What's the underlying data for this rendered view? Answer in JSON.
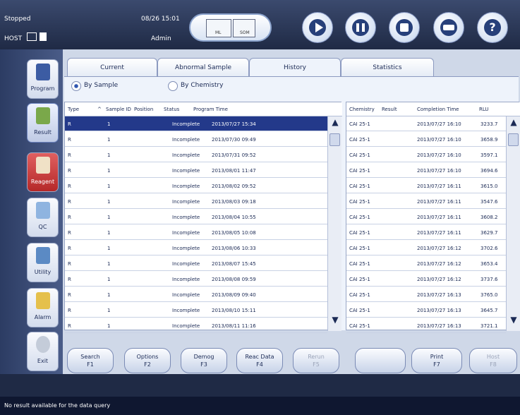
{
  "status": {
    "state": "Stopped",
    "datetime": "08/26 15:01",
    "host_label": "HOST",
    "user": "Admin"
  },
  "host_modules": {
    "module1": "ML",
    "module2": "SOM"
  },
  "sidebar": {
    "items": [
      {
        "label": "Program",
        "icon": "program-icon"
      },
      {
        "label": "Result",
        "icon": "result-icon"
      },
      {
        "label": "Reagent",
        "icon": "reagent-icon"
      },
      {
        "label": "QC",
        "icon": "qc-icon"
      },
      {
        "label": "Utility",
        "icon": "utility-icon"
      },
      {
        "label": "Alarm",
        "icon": "alarm-icon"
      },
      {
        "label": "Exit",
        "icon": "exit-icon"
      }
    ]
  },
  "tabs": [
    "Current",
    "Abnormal Sample",
    "History",
    "Statistics"
  ],
  "radio": {
    "by_sample": "By Sample",
    "by_chemistry": "By Chemistry"
  },
  "table1": {
    "headers": [
      "Type",
      "^",
      "Sample ID",
      "Position",
      "Status",
      "Program Time"
    ],
    "rows": [
      [
        "R",
        "1",
        "Incomplete",
        "2013/07/27 15:34"
      ],
      [
        "R",
        "1",
        "Incomplete",
        "2013/07/30 09:49"
      ],
      [
        "R",
        "1",
        "Incomplete",
        "2013/07/31 09:52"
      ],
      [
        "R",
        "1",
        "Incomplete",
        "2013/08/01 11:47"
      ],
      [
        "R",
        "1",
        "Incomplete",
        "2013/08/02 09:52"
      ],
      [
        "R",
        "1",
        "Incomplete",
        "2013/08/03 09:18"
      ],
      [
        "R",
        "1",
        "Incomplete",
        "2013/08/04 10:55"
      ],
      [
        "R",
        "1",
        "Incomplete",
        "2013/08/05 10:08"
      ],
      [
        "R",
        "1",
        "Incomplete",
        "2013/08/06 10:33"
      ],
      [
        "R",
        "1",
        "Incomplete",
        "2013/08/07 15:45"
      ],
      [
        "R",
        "1",
        "Incomplete",
        "2013/08/08 09:59"
      ],
      [
        "R",
        "1",
        "Incomplete",
        "2013/08/09 09:40"
      ],
      [
        "R",
        "1",
        "Incomplete",
        "2013/08/10 15:11"
      ],
      [
        "R",
        "1",
        "Incomplete",
        "2013/08/11 11:16"
      ]
    ]
  },
  "table2": {
    "headers": [
      "Chemistry",
      "Result",
      "Completion Time",
      "RLU"
    ],
    "rows": [
      [
        "CAI 25-1",
        "2013/07/27 16:10",
        "3233.7"
      ],
      [
        "CAI 25-1",
        "2013/07/27 16:10",
        "3658.9"
      ],
      [
        "CAI 25-1",
        "2013/07/27 16:10",
        "3597.1"
      ],
      [
        "CAI 25-1",
        "2013/07/27 16:10",
        "3694.6"
      ],
      [
        "CAI 25-1",
        "2013/07/27 16:11",
        "3615.0"
      ],
      [
        "CAI 25-1",
        "2013/07/27 16:11",
        "3547.6"
      ],
      [
        "CAI 25-1",
        "2013/07/27 16:11",
        "3608.2"
      ],
      [
        "CAI 25-1",
        "2013/07/27 16:11",
        "3629.7"
      ],
      [
        "CAI 25-1",
        "2013/07/27 16:12",
        "3702.6"
      ],
      [
        "CAI 25-1",
        "2013/07/27 16:12",
        "3653.4"
      ],
      [
        "CAI 25-1",
        "2013/07/27 16:12",
        "3737.6"
      ],
      [
        "CAI 25-1",
        "2013/07/27 16:13",
        "3765.0"
      ],
      [
        "CAI 25-1",
        "2013/07/27 16:13",
        "3645.7"
      ],
      [
        "CAI 25-1",
        "2013/07/27 16:13",
        "3721.1"
      ]
    ]
  },
  "fkeys": [
    [
      "Search",
      "F1"
    ],
    [
      "Options",
      "F2"
    ],
    [
      "Demog",
      "F3"
    ],
    [
      "Reac Data",
      "F4"
    ],
    [
      "Rerun",
      "F5"
    ],
    [
      "",
      ""
    ],
    [
      "Print",
      "F7"
    ],
    [
      "Host",
      "F8"
    ]
  ],
  "statusbar": {
    "message": "No result available for the data query"
  }
}
